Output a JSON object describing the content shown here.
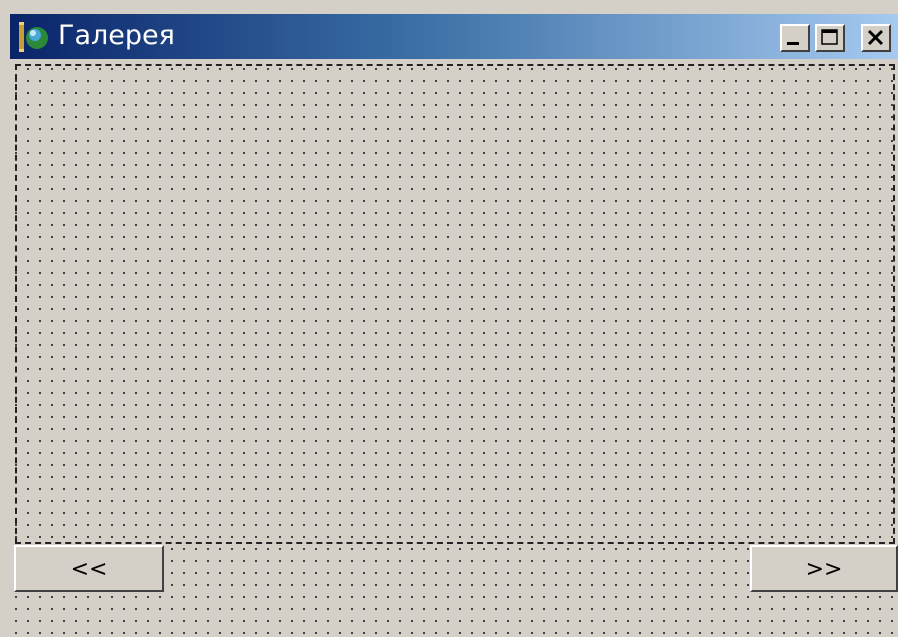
{
  "window": {
    "title": "Галерея",
    "controls": {
      "minimize": "_",
      "maximize": "□",
      "close": "×"
    }
  },
  "navigation": {
    "prev_label": "<<",
    "next_label": ">>"
  },
  "colors": {
    "titlebar_start": "#0a246a",
    "titlebar_end": "#a6caf0",
    "face": "#d4d0c8"
  }
}
